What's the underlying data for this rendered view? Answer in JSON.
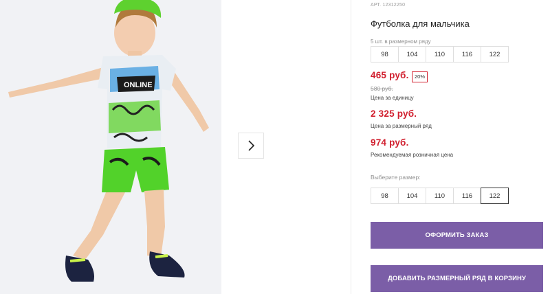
{
  "gallery": {
    "next_icon": "chevron-right-icon",
    "shirt_print_text": "ONLINE"
  },
  "product": {
    "article": "АРТ. 12312250",
    "title": "Футболка для мальчика",
    "row_note": "5 шт. в размерном ряду",
    "row_sizes": [
      "98",
      "104",
      "110",
      "116",
      "122"
    ]
  },
  "prices": {
    "unit_price": "465 руб.",
    "discount": "20%",
    "old_price": "580 руб.",
    "unit_label": "Цена за единицу",
    "row_price": "2 325 руб.",
    "row_label": "Цена за размерный ряд",
    "retail_price": "974 руб.",
    "retail_label": "Рекомендуемая розничная цена"
  },
  "size_picker": {
    "label": "Выберите размер:",
    "sizes": [
      "98",
      "104",
      "110",
      "116",
      "122"
    ],
    "selected": "122"
  },
  "actions": {
    "order_label": "ОФОРМИТЬ ЗАКАЗ",
    "cart_label": "ДОБАВИТЬ РАЗМЕРНЫЙ РЯД В КОРЗИНУ"
  },
  "colors": {
    "accent": "#7b5ea7",
    "price_red": "#d1202f"
  }
}
